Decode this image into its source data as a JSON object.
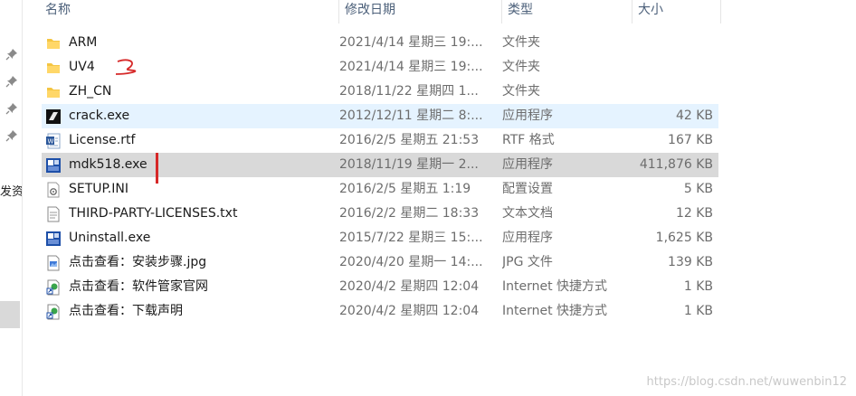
{
  "columns": {
    "name": "名称",
    "date": "修改日期",
    "type": "类型",
    "size": "大小"
  },
  "nav": {
    "partial_text": "发资"
  },
  "files": [
    {
      "name": "ARM",
      "date": "2021/4/14 星期三 19:...",
      "type": "文件夹",
      "size": "",
      "icon": "folder-icon"
    },
    {
      "name": "UV4",
      "date": "2021/4/14 星期三 19:...",
      "type": "文件夹",
      "size": "",
      "icon": "folder-icon"
    },
    {
      "name": "ZH_CN",
      "date": "2018/11/22 星期四 1...",
      "type": "文件夹",
      "size": "",
      "icon": "folder-icon"
    },
    {
      "name": "crack.exe",
      "date": "2012/12/11 星期二 8:...",
      "type": "应用程序",
      "size": "42 KB",
      "icon": "exe-black-icon"
    },
    {
      "name": "License.rtf",
      "date": "2016/2/5 星期五 21:53",
      "type": "RTF 格式",
      "size": "167 KB",
      "icon": "word-doc-icon"
    },
    {
      "name": "mdk518.exe",
      "date": "2018/11/19 星期一 2...",
      "type": "应用程序",
      "size": "411,876 KB",
      "icon": "installer-icon"
    },
    {
      "name": "SETUP.INI",
      "date": "2016/2/5 星期五 1:19",
      "type": "配置设置",
      "size": "5 KB",
      "icon": "ini-settings-icon"
    },
    {
      "name": "THIRD-PARTY-LICENSES.txt",
      "date": "2016/2/2 星期二 18:33",
      "type": "文本文档",
      "size": "12 KB",
      "icon": "text-file-icon"
    },
    {
      "name": "Uninstall.exe",
      "date": "2015/7/22 星期三 15:...",
      "type": "应用程序",
      "size": "1,625 KB",
      "icon": "installer-icon"
    },
    {
      "name": "点击查看：安装步骤.jpg",
      "date": "2020/4/20 星期一 14:...",
      "type": "JPG 文件",
      "size": "139 KB",
      "icon": "image-file-icon"
    },
    {
      "name": "点击查看：软件管家官网",
      "date": "2020/4/2 星期四 12:04",
      "type": "Internet 快捷方式",
      "size": "1 KB",
      "icon": "shortcut-icon"
    },
    {
      "name": "点击查看：下载声明",
      "date": "2020/4/2 星期四 12:04",
      "type": "Internet 快捷方式",
      "size": "1 KB",
      "icon": "shortcut-icon"
    }
  ],
  "watermark": "https://blog.csdn.net/wuwenbin12",
  "colors": {
    "hover": "#e5f3ff",
    "selected": "#d9d9d9",
    "header_text": "#4c607a",
    "annotation": "#d62828"
  }
}
